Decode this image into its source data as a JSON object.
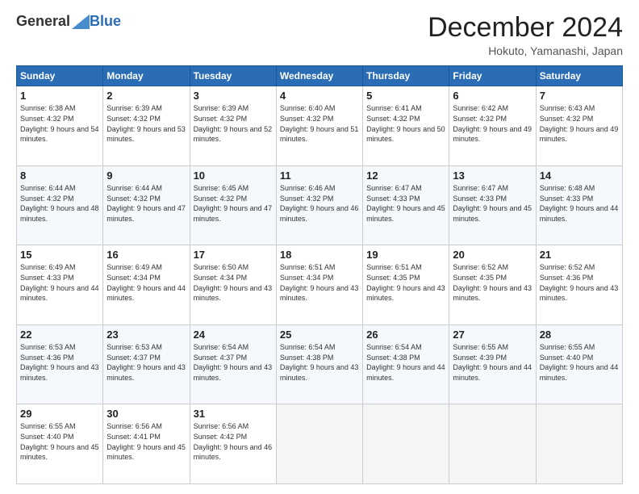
{
  "header": {
    "logo_general": "General",
    "logo_blue": "Blue",
    "month_title": "December 2024",
    "location": "Hokuto, Yamanashi, Japan"
  },
  "days_of_week": [
    "Sunday",
    "Monday",
    "Tuesday",
    "Wednesday",
    "Thursday",
    "Friday",
    "Saturday"
  ],
  "weeks": [
    [
      {
        "day": "1",
        "sunrise": "6:38 AM",
        "sunset": "4:32 PM",
        "daylight": "9 hours and 54 minutes."
      },
      {
        "day": "2",
        "sunrise": "6:39 AM",
        "sunset": "4:32 PM",
        "daylight": "9 hours and 53 minutes."
      },
      {
        "day": "3",
        "sunrise": "6:39 AM",
        "sunset": "4:32 PM",
        "daylight": "9 hours and 52 minutes."
      },
      {
        "day": "4",
        "sunrise": "6:40 AM",
        "sunset": "4:32 PM",
        "daylight": "9 hours and 51 minutes."
      },
      {
        "day": "5",
        "sunrise": "6:41 AM",
        "sunset": "4:32 PM",
        "daylight": "9 hours and 50 minutes."
      },
      {
        "day": "6",
        "sunrise": "6:42 AM",
        "sunset": "4:32 PM",
        "daylight": "9 hours and 49 minutes."
      },
      {
        "day": "7",
        "sunrise": "6:43 AM",
        "sunset": "4:32 PM",
        "daylight": "9 hours and 49 minutes."
      }
    ],
    [
      {
        "day": "8",
        "sunrise": "6:44 AM",
        "sunset": "4:32 PM",
        "daylight": "9 hours and 48 minutes."
      },
      {
        "day": "9",
        "sunrise": "6:44 AM",
        "sunset": "4:32 PM",
        "daylight": "9 hours and 47 minutes."
      },
      {
        "day": "10",
        "sunrise": "6:45 AM",
        "sunset": "4:32 PM",
        "daylight": "9 hours and 47 minutes."
      },
      {
        "day": "11",
        "sunrise": "6:46 AM",
        "sunset": "4:32 PM",
        "daylight": "9 hours and 46 minutes."
      },
      {
        "day": "12",
        "sunrise": "6:47 AM",
        "sunset": "4:33 PM",
        "daylight": "9 hours and 45 minutes."
      },
      {
        "day": "13",
        "sunrise": "6:47 AM",
        "sunset": "4:33 PM",
        "daylight": "9 hours and 45 minutes."
      },
      {
        "day": "14",
        "sunrise": "6:48 AM",
        "sunset": "4:33 PM",
        "daylight": "9 hours and 44 minutes."
      }
    ],
    [
      {
        "day": "15",
        "sunrise": "6:49 AM",
        "sunset": "4:33 PM",
        "daylight": "9 hours and 44 minutes."
      },
      {
        "day": "16",
        "sunrise": "6:49 AM",
        "sunset": "4:34 PM",
        "daylight": "9 hours and 44 minutes."
      },
      {
        "day": "17",
        "sunrise": "6:50 AM",
        "sunset": "4:34 PM",
        "daylight": "9 hours and 43 minutes."
      },
      {
        "day": "18",
        "sunrise": "6:51 AM",
        "sunset": "4:34 PM",
        "daylight": "9 hours and 43 minutes."
      },
      {
        "day": "19",
        "sunrise": "6:51 AM",
        "sunset": "4:35 PM",
        "daylight": "9 hours and 43 minutes."
      },
      {
        "day": "20",
        "sunrise": "6:52 AM",
        "sunset": "4:35 PM",
        "daylight": "9 hours and 43 minutes."
      },
      {
        "day": "21",
        "sunrise": "6:52 AM",
        "sunset": "4:36 PM",
        "daylight": "9 hours and 43 minutes."
      }
    ],
    [
      {
        "day": "22",
        "sunrise": "6:53 AM",
        "sunset": "4:36 PM",
        "daylight": "9 hours and 43 minutes."
      },
      {
        "day": "23",
        "sunrise": "6:53 AM",
        "sunset": "4:37 PM",
        "daylight": "9 hours and 43 minutes."
      },
      {
        "day": "24",
        "sunrise": "6:54 AM",
        "sunset": "4:37 PM",
        "daylight": "9 hours and 43 minutes."
      },
      {
        "day": "25",
        "sunrise": "6:54 AM",
        "sunset": "4:38 PM",
        "daylight": "9 hours and 43 minutes."
      },
      {
        "day": "26",
        "sunrise": "6:54 AM",
        "sunset": "4:38 PM",
        "daylight": "9 hours and 44 minutes."
      },
      {
        "day": "27",
        "sunrise": "6:55 AM",
        "sunset": "4:39 PM",
        "daylight": "9 hours and 44 minutes."
      },
      {
        "day": "28",
        "sunrise": "6:55 AM",
        "sunset": "4:40 PM",
        "daylight": "9 hours and 44 minutes."
      }
    ],
    [
      {
        "day": "29",
        "sunrise": "6:55 AM",
        "sunset": "4:40 PM",
        "daylight": "9 hours and 45 minutes."
      },
      {
        "day": "30",
        "sunrise": "6:56 AM",
        "sunset": "4:41 PM",
        "daylight": "9 hours and 45 minutes."
      },
      {
        "day": "31",
        "sunrise": "6:56 AM",
        "sunset": "4:42 PM",
        "daylight": "9 hours and 46 minutes."
      },
      null,
      null,
      null,
      null
    ]
  ]
}
